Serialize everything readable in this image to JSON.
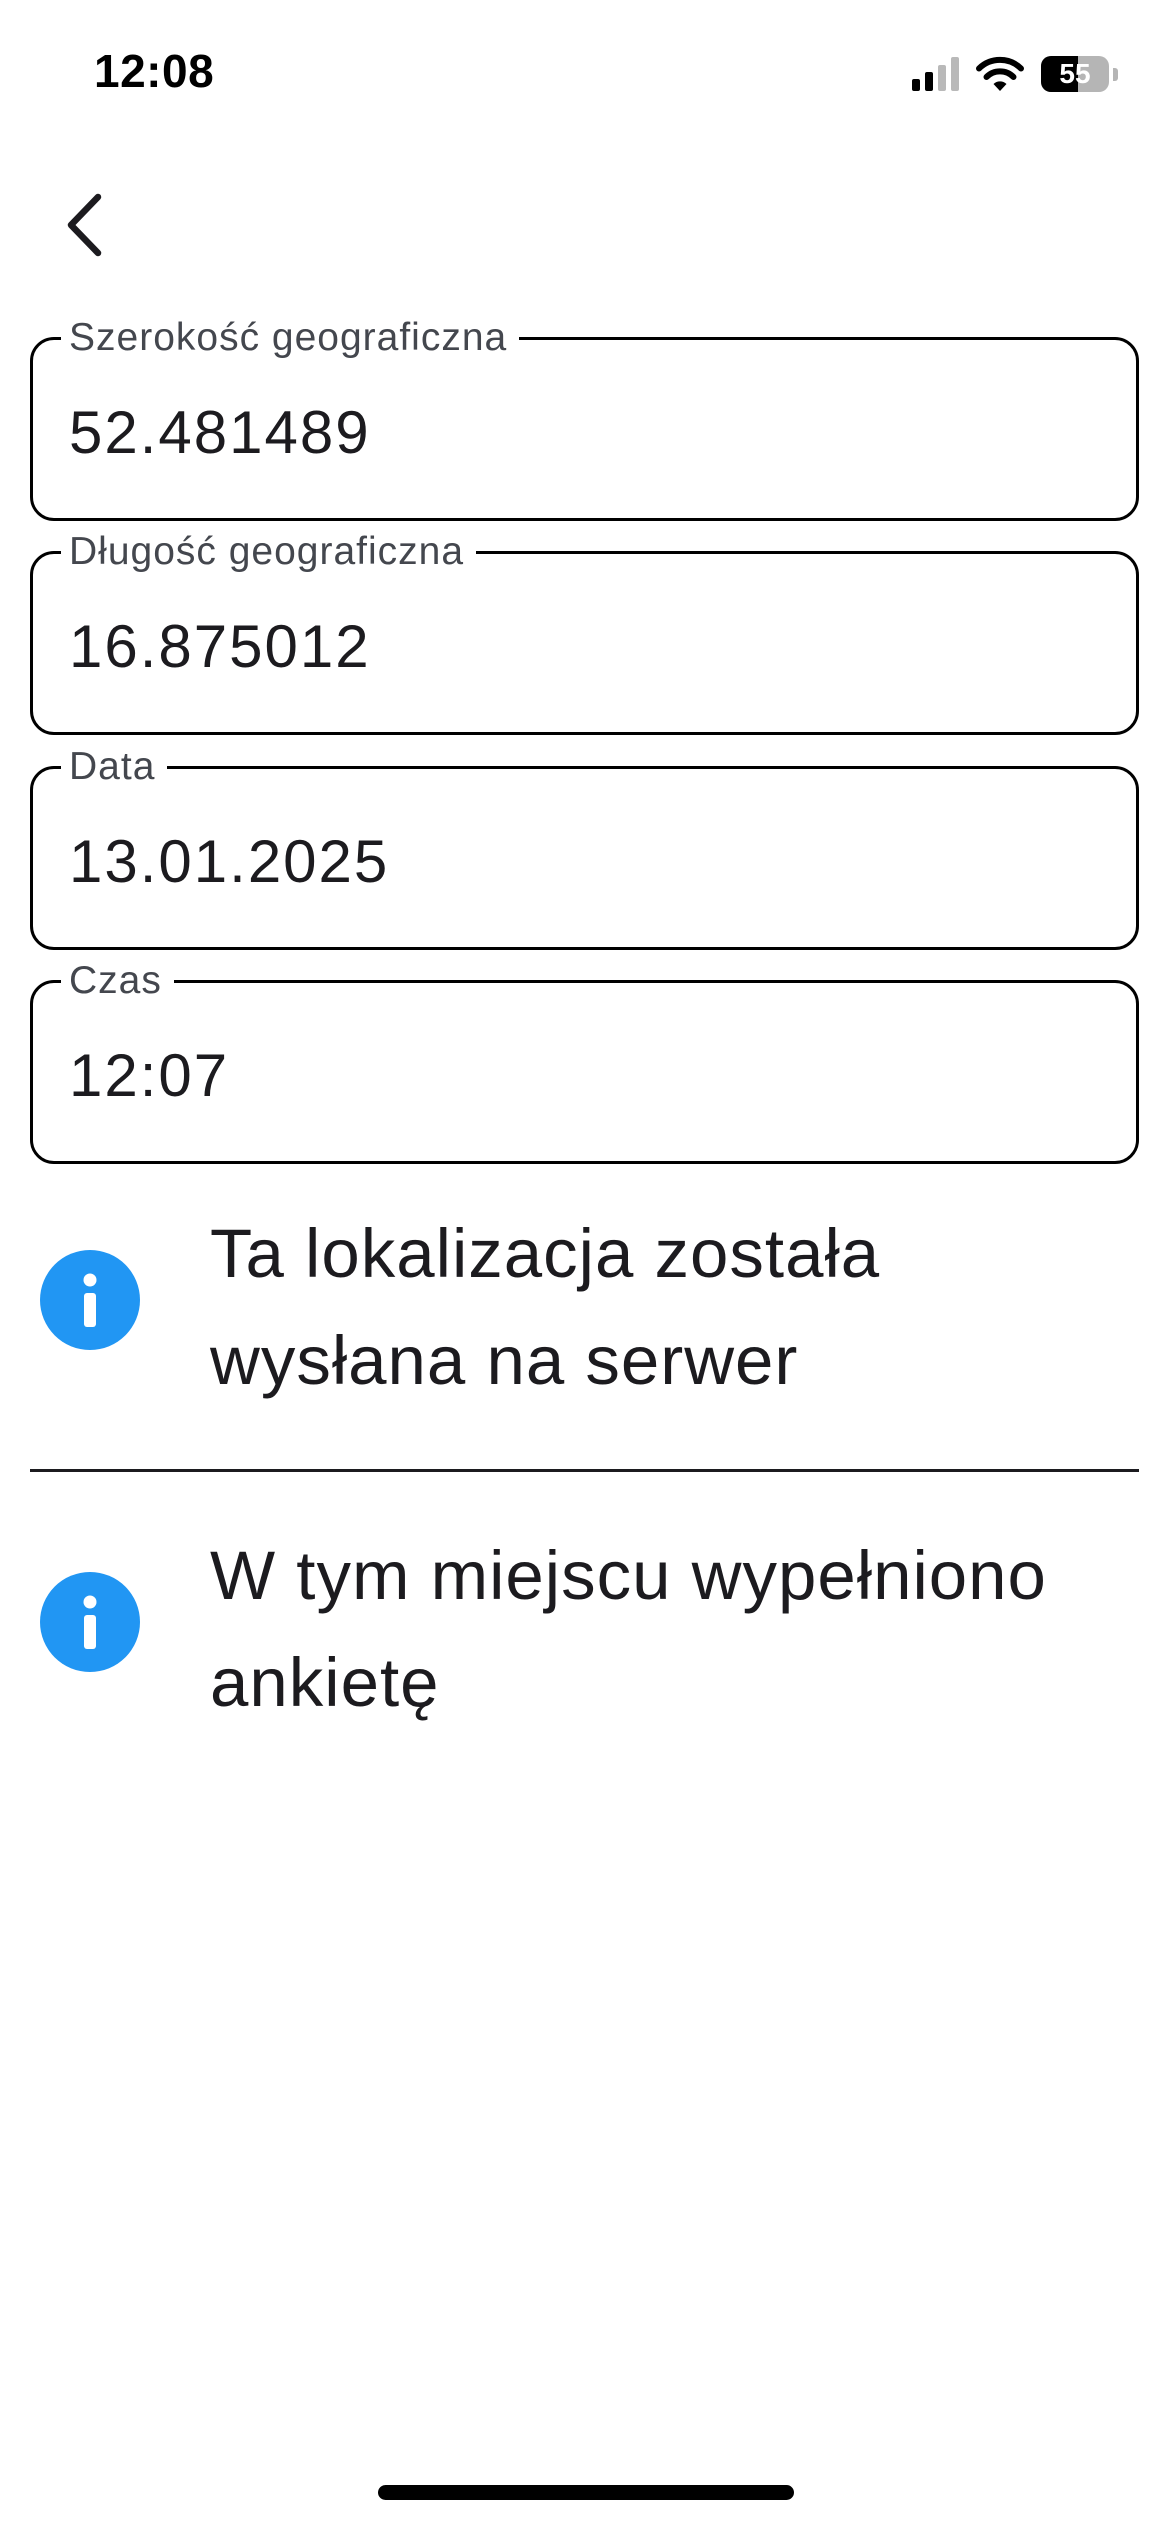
{
  "status_bar": {
    "time": "12:08",
    "battery_level": "55",
    "signal_bars_active": 2,
    "signal_bars_total": 4,
    "icons": [
      "signal-icon",
      "wifi-icon",
      "battery-icon"
    ]
  },
  "nav": {
    "back_icon": "chevron-left-icon"
  },
  "fields": {
    "latitude": {
      "label": "Szerokość geograficzna",
      "value": "52.481489"
    },
    "longitude": {
      "label": "Długość geograficzna",
      "value": "16.875012"
    },
    "date": {
      "label": "Data",
      "value": "13.01.2025"
    },
    "time": {
      "label": "Czas",
      "value": "12:07"
    }
  },
  "info": {
    "sent": {
      "icon": "info-icon",
      "text": "Ta lokalizacja została wysłana na serwer"
    },
    "survey": {
      "icon": "info-icon",
      "text": "W tym miejscu wypełniono ankietę"
    }
  },
  "colors": {
    "accent": "#2196F3",
    "border": "#000000",
    "text": "#1C1B1F",
    "label": "#44474E",
    "background": "#FFFFFF"
  }
}
